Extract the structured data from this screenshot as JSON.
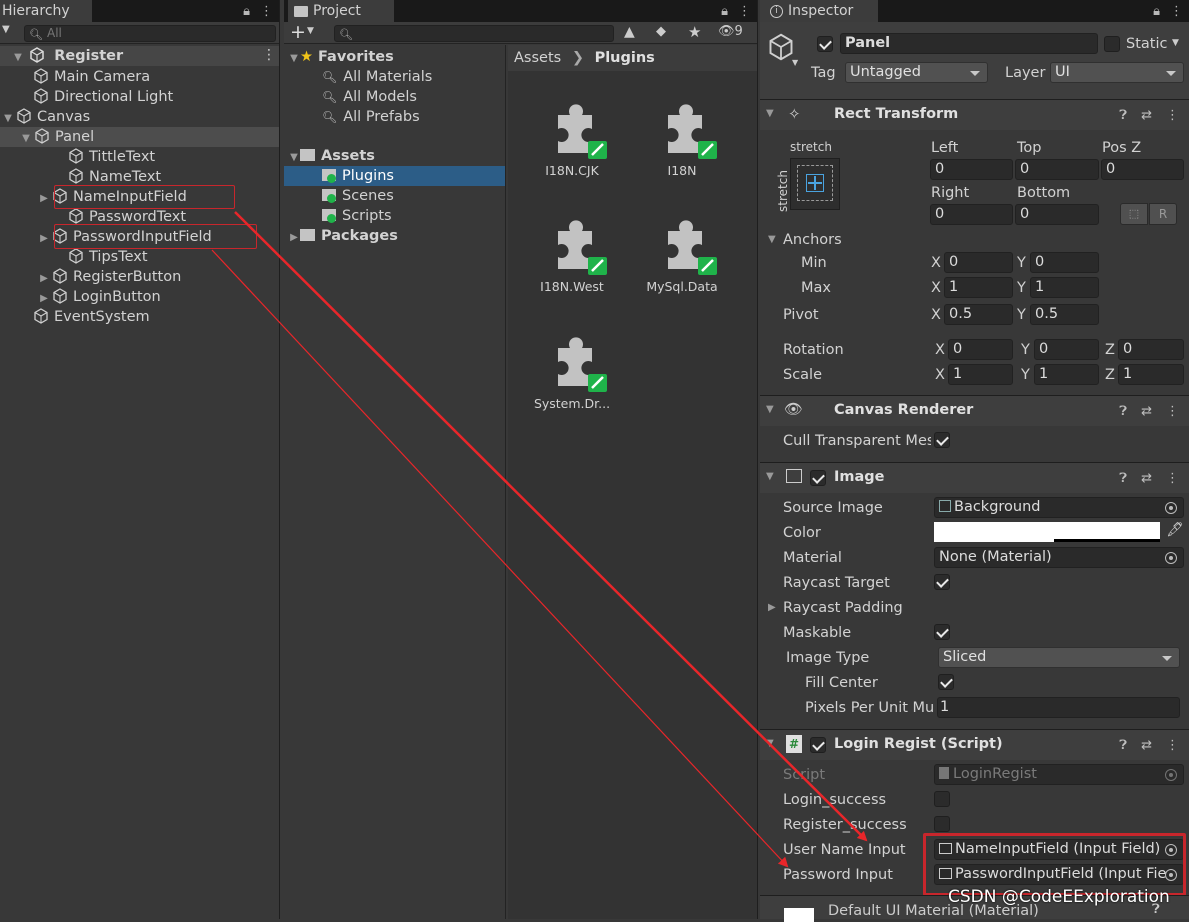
{
  "hierarchy": {
    "tab": "Hierarchy",
    "search_placeholder": "All",
    "scene": "Register",
    "items": [
      "Main Camera",
      "Directional Light",
      "Canvas",
      "Panel",
      "TittleText",
      "NameText",
      "NameInputField",
      "PasswordText",
      "PasswordInputField",
      "TipsText",
      "RegisterButton",
      "LoginButton",
      "EventSystem"
    ]
  },
  "project": {
    "tab": "Project",
    "hidden_count": "9",
    "favorites_label": "Favorites",
    "favorites": [
      "All Materials",
      "All Models",
      "All Prefabs"
    ],
    "assets_label": "Assets",
    "asset_folders": [
      "Plugins",
      "Scenes",
      "Scripts"
    ],
    "packages_label": "Packages",
    "breadcrumb": [
      "Assets",
      "Plugins"
    ],
    "files": [
      "I18N.CJK",
      "I18N",
      "I18N.West",
      "MySql.Data",
      "System.Dr..."
    ]
  },
  "inspector": {
    "tab": "Inspector",
    "object_name": "Panel",
    "static_label": "Static",
    "tag_label": "Tag",
    "tag_value": "Untagged",
    "layer_label": "Layer",
    "layer_value": "UI",
    "rect": {
      "title": "Rect Transform",
      "anchor_top": "stretch",
      "anchor_side": "stretch",
      "left_label": "Left",
      "left": "0",
      "top_label": "Top",
      "top": "0",
      "posz_label": "Pos Z",
      "posz": "0",
      "right_label": "Right",
      "right": "0",
      "bottom_label": "Bottom",
      "bottom": "0",
      "r_btn": "R",
      "anchors_label": "Anchors",
      "min_label": "Min",
      "min_x": "0",
      "min_y": "0",
      "max_label": "Max",
      "max_x": "1",
      "max_y": "1",
      "pivot_label": "Pivot",
      "pivot_x": "0.5",
      "pivot_y": "0.5",
      "rotation_label": "Rotation",
      "rot_x": "0",
      "rot_y": "0",
      "rot_z": "0",
      "scale_label": "Scale",
      "scale_x": "1",
      "scale_y": "1",
      "scale_z": "1",
      "x": "X",
      "y": "Y",
      "z": "Z"
    },
    "canvas_renderer": {
      "title": "Canvas Renderer",
      "cull_label": "Cull Transparent Mes"
    },
    "image": {
      "title": "Image",
      "source_label": "Source Image",
      "source_value": "Background",
      "color_label": "Color",
      "material_label": "Material",
      "material_value": "None (Material)",
      "raycast_label": "Raycast Target",
      "padding_label": "Raycast Padding",
      "maskable_label": "Maskable",
      "type_label": "Image Type",
      "type_value": "Sliced",
      "fill_label": "Fill Center",
      "ppu_label": "Pixels Per Unit Mu",
      "ppu_value": "1",
      "color_hex": "#ffffff"
    },
    "script": {
      "title": "Login Regist (Script)",
      "script_label": "Script",
      "script_value": "LoginRegist",
      "login_success": "Login_success",
      "register_success": "Register_success",
      "user_name_label": "User Name Input",
      "user_name_value": "NameInputField (Input Field)",
      "password_label": "Password Input",
      "password_value": "PasswordInputField (Input Fie"
    },
    "default_material": "Default UI Material (Material)"
  },
  "watermark": "CSDN @CodeEExploration",
  "accent": "#2c5d87",
  "annotation_color": "#e8262a"
}
